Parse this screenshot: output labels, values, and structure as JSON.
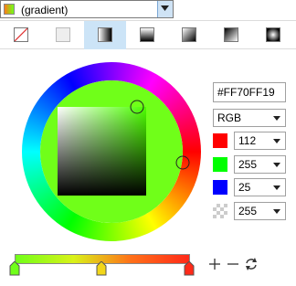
{
  "fill_type": {
    "label": "(gradient)",
    "swatch_colors": [
      "#ff7a19",
      "#70ff19"
    ]
  },
  "toolbar": {
    "items": [
      {
        "name": "no-fill"
      },
      {
        "name": "solid-fill"
      },
      {
        "name": "linear-gradient",
        "active": true
      },
      {
        "name": "linear-gradient-vertical"
      },
      {
        "name": "diagonal-gradient"
      },
      {
        "name": "reflected-gradient"
      },
      {
        "name": "radial-gradient"
      }
    ]
  },
  "color": {
    "hex": "#FF70FF19",
    "model": "RGB",
    "channels": [
      {
        "name": "red",
        "chip": "#ff0000",
        "value": "112"
      },
      {
        "name": "green",
        "chip": "#00ff00",
        "value": "255"
      },
      {
        "name": "blue",
        "chip": "#0000ff",
        "value": "25"
      },
      {
        "name": "alpha",
        "chip": "checker",
        "value": "255"
      }
    ],
    "current": "#70ff19"
  },
  "gradient": {
    "stops": [
      {
        "position": 0.0,
        "color": "#70ff19"
      },
      {
        "position": 0.5,
        "color": "#f2d619"
      },
      {
        "position": 1.0,
        "color": "#ff2a19"
      }
    ],
    "buttons": {
      "add": "+",
      "remove": "−",
      "reverse": "⟳"
    }
  }
}
